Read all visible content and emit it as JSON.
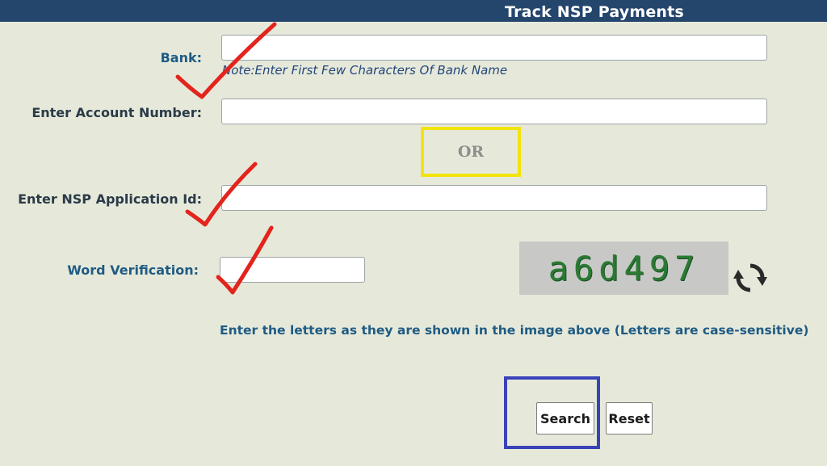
{
  "header": {
    "title": "Track NSP Payments"
  },
  "form": {
    "bank": {
      "label": "Bank:",
      "value": "",
      "note": "Note:Enter First Few Characters Of Bank Name"
    },
    "account_number": {
      "label": "Enter Account Number:",
      "value": ""
    },
    "separator": "OR",
    "application_id": {
      "label": "Enter NSP Application Id:",
      "value": ""
    },
    "word_verification": {
      "label": "Word Verification:",
      "value": ""
    },
    "captcha": {
      "text": "a6d497"
    },
    "hint": "Enter the letters as they are shown in the image above (Letters are case-sensitive)",
    "buttons": {
      "search": "Search",
      "reset": "Reset"
    }
  },
  "annotations": {
    "check_color": "#e3241d",
    "highlight_yellow": "#f2e40a",
    "highlight_blue": "#3a42b8"
  },
  "icons": {
    "refresh": "refresh-icon"
  }
}
